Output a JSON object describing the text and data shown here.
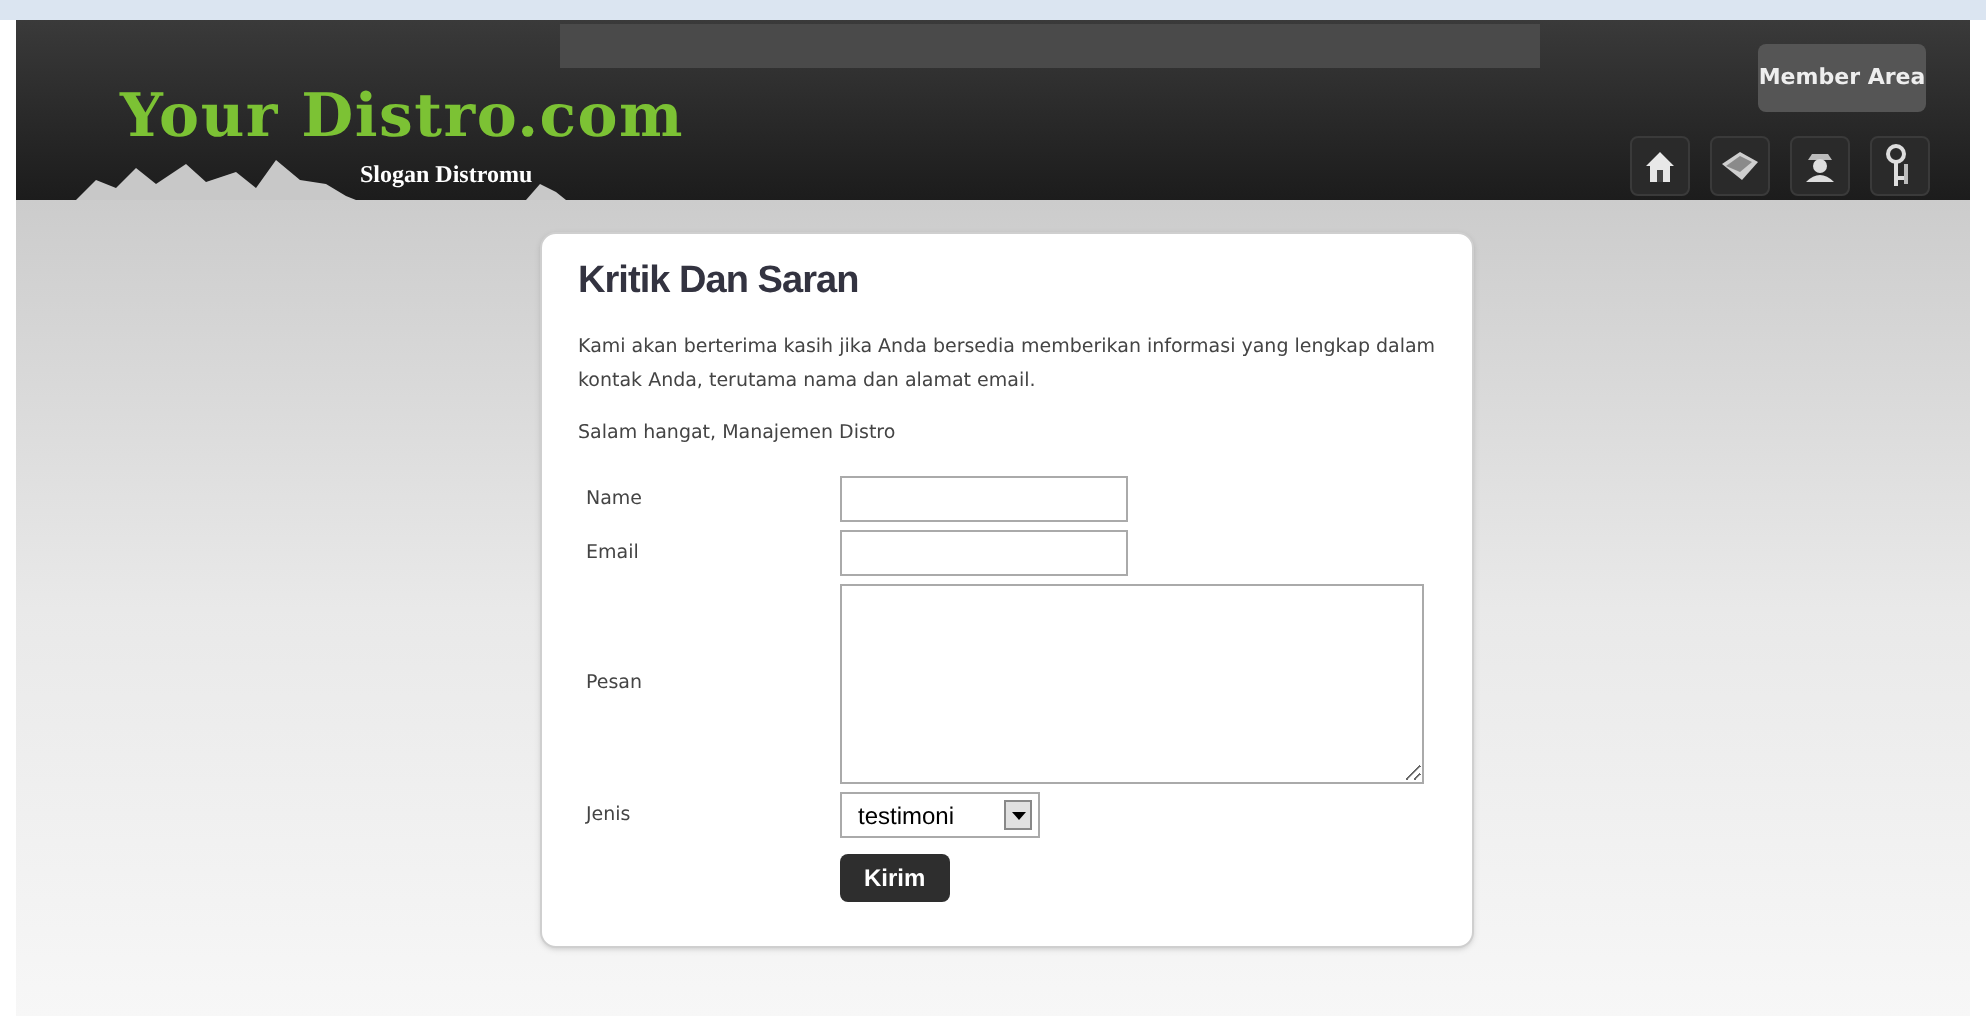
{
  "header": {
    "logo": "Your Distro.com",
    "slogan": "Slogan Distromu",
    "member_button": "Member Area"
  },
  "form": {
    "title": "Kritik Dan Saran",
    "intro": "Kami akan berterima kasih jika Anda bersedia memberikan informasi yang lengkap dalam kontak Anda, terutama nama dan alamat email.",
    "greeting": "Salam hangat, Manajemen Distro",
    "fields": [
      {
        "kind": "text",
        "label": "Name"
      },
      {
        "kind": "text",
        "label": "Email"
      },
      {
        "kind": "textarea",
        "label": "Pesan"
      },
      {
        "kind": "select",
        "label": "Jenis",
        "value": "testimoni"
      }
    ],
    "submit": "Kirim"
  }
}
